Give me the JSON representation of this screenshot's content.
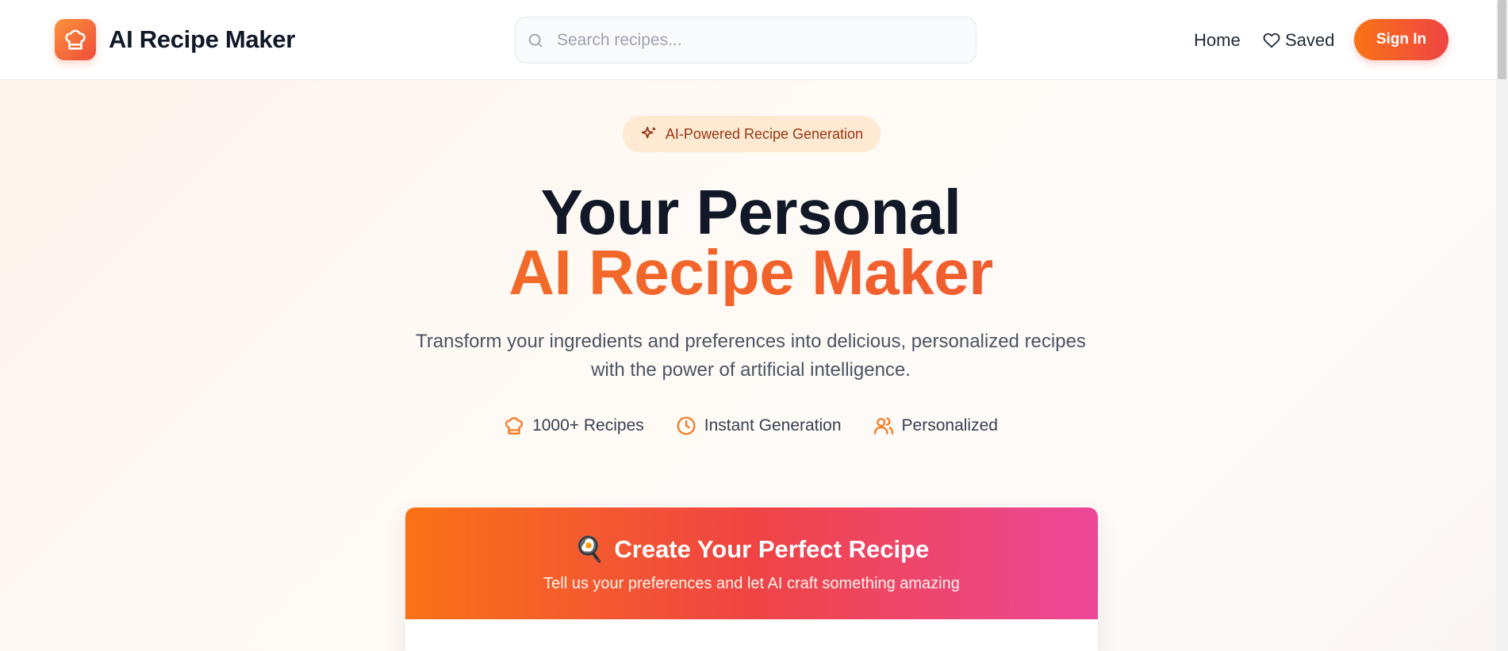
{
  "header": {
    "app_title": "AI Recipe Maker",
    "logo_icon": "chef-hat-icon",
    "search": {
      "placeholder": "Search recipes...",
      "value": ""
    },
    "nav": {
      "home_label": "Home",
      "saved_label": "Saved"
    },
    "sign_in_label": "Sign In"
  },
  "hero": {
    "badge_label": "AI-Powered Recipe Generation",
    "title_line1": "Your Personal",
    "title_line2": "AI Recipe Maker",
    "subtitle": "Transform your ingredients and preferences into delicious, personalized recipes with the power of artificial intelligence.",
    "features": [
      {
        "icon": "chef-hat-icon",
        "label": "1000+ Recipes"
      },
      {
        "icon": "clock-icon",
        "label": "Instant Generation"
      },
      {
        "icon": "users-icon",
        "label": "Personalized"
      }
    ]
  },
  "create_card": {
    "title": "Create Your Perfect Recipe",
    "emoji": "🍳",
    "subtitle": "Tell us your preferences and let AI craft something amazing"
  },
  "colors": {
    "accent_orange": "#f97316",
    "accent_red": "#ef4444",
    "accent_pink": "#ec4899",
    "heading_dark": "#111827",
    "badge_bg": "#feead3"
  }
}
